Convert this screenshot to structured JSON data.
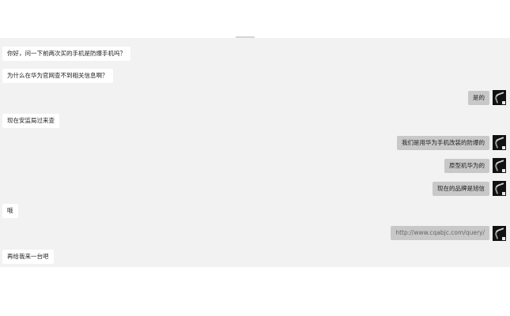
{
  "conversation": {
    "messages": [
      {
        "side": "in",
        "text": "你好，问一下前两次买的手机是防爆手机吗？"
      },
      {
        "side": "in",
        "text": "为什么在华为官网查不到相关信息啊？"
      },
      {
        "side": "out",
        "text": "是的"
      },
      {
        "side": "in",
        "text": "现在安监局过来查"
      },
      {
        "side": "out",
        "text": "我们是用华为手机改装的防爆的"
      },
      {
        "side": "out",
        "text": "原型机华为的"
      },
      {
        "side": "out",
        "text": "现在的品牌是旭信"
      },
      {
        "side": "in",
        "text": "哦"
      },
      {
        "side": "out",
        "text": "http://www.cqabjc.com/query/"
      },
      {
        "side": "in",
        "text": "再给我来一台吧"
      }
    ]
  },
  "colors": {
    "panel_bg": "#f2f2f2",
    "incoming_bubble": "#ffffff",
    "outgoing_bubble": "#c8c8c8",
    "avatar_bg": "#111111"
  }
}
